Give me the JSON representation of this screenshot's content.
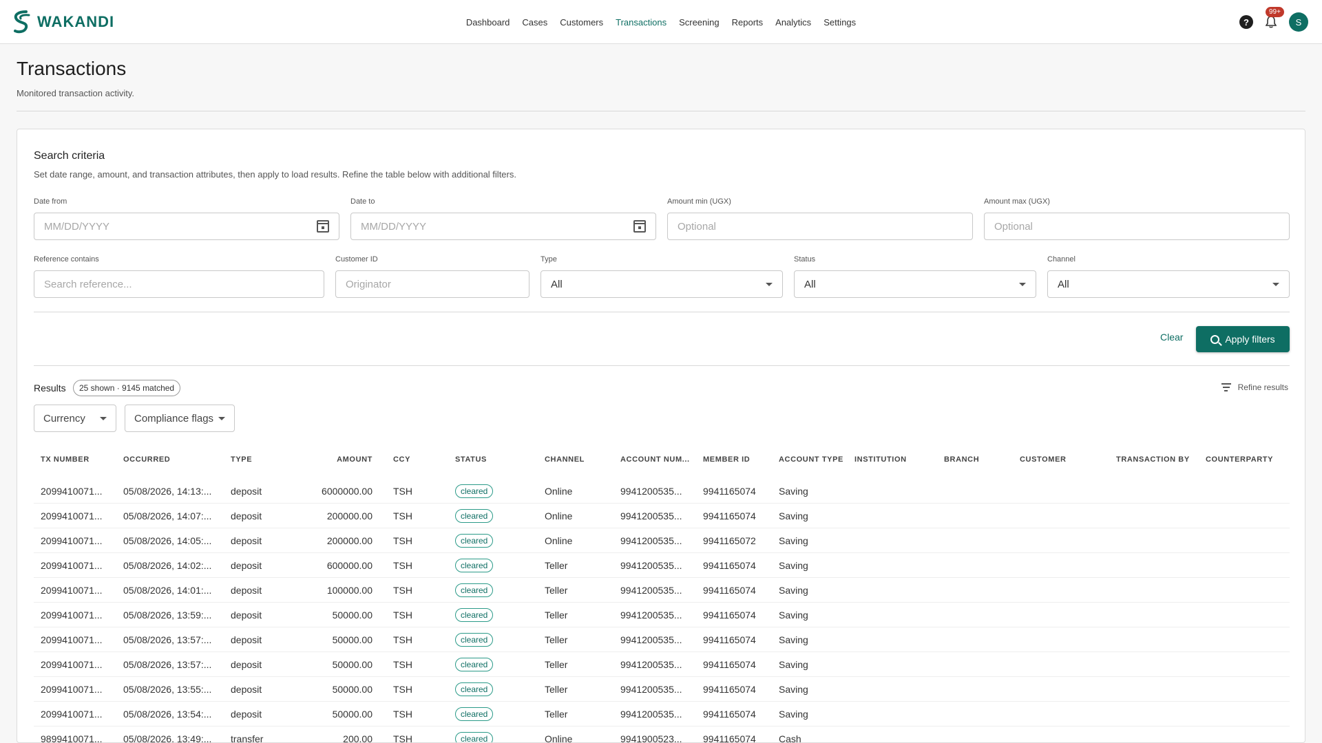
{
  "app": {
    "logo_text": "WAKANDI"
  },
  "nav": {
    "items": [
      "Dashboard",
      "Cases",
      "Customers",
      "Transactions",
      "Screening",
      "Reports",
      "Analytics",
      "Settings"
    ],
    "active": "Transactions"
  },
  "topbar": {
    "help": "?",
    "notifications_badge": "99+",
    "avatar_initial": "S"
  },
  "page": {
    "title": "Transactions",
    "subtitle": "Monitored transaction activity."
  },
  "search": {
    "title": "Search criteria",
    "description": "Set date range, amount, and transaction attributes, then apply to load results. Refine the table below with additional filters.",
    "date_from": {
      "label": "Date from",
      "placeholder": "MM/DD/YYYY"
    },
    "date_to": {
      "label": "Date to",
      "placeholder": "MM/DD/YYYY"
    },
    "amount_min": {
      "label": "Amount min (UGX)",
      "placeholder": "Optional"
    },
    "amount_max": {
      "label": "Amount max (UGX)",
      "placeholder": "Optional"
    },
    "reference": {
      "label": "Reference contains",
      "placeholder": "Search reference..."
    },
    "customer_id": {
      "label": "Customer ID",
      "placeholder": "Originator"
    },
    "type": {
      "label": "Type",
      "value": "All"
    },
    "status": {
      "label": "Status",
      "value": "All"
    },
    "channel": {
      "label": "Channel",
      "value": "All"
    },
    "clear_label": "Clear",
    "apply_label": "Apply filters"
  },
  "results": {
    "label": "Results",
    "count_chip": "25 shown · 9145 matched",
    "refine_label": "Refine results",
    "currency_filter": "Currency",
    "flags_filter": "Compliance flags"
  },
  "table": {
    "headers": [
      "TX NUMBER",
      "OCCURRED",
      "TYPE",
      "AMOUNT",
      "CCY",
      "STATUS",
      "CHANNEL",
      "ACCOUNT NUM...",
      "MEMBER ID",
      "ACCOUNT TYPE",
      "INSTITUTION",
      "BRANCH",
      "CUSTOMER",
      "TRANSACTION BY",
      "COUNTERPARTY"
    ],
    "rows": [
      [
        "2099410071...",
        "05/08/2026, 14:13:...",
        "deposit",
        "6000000.00",
        "TSH",
        "cleared",
        "Online",
        "9941200535...",
        "9941165074",
        "Saving"
      ],
      [
        "2099410071...",
        "05/08/2026, 14:07:...",
        "deposit",
        "200000.00",
        "TSH",
        "cleared",
        "Online",
        "9941200535...",
        "9941165074",
        "Saving"
      ],
      [
        "2099410071...",
        "05/08/2026, 14:05:...",
        "deposit",
        "200000.00",
        "TSH",
        "cleared",
        "Online",
        "9941200535...",
        "9941165072",
        "Saving"
      ],
      [
        "2099410071...",
        "05/08/2026, 14:02:...",
        "deposit",
        "600000.00",
        "TSH",
        "cleared",
        "Teller",
        "9941200535...",
        "9941165074",
        "Saving"
      ],
      [
        "2099410071...",
        "05/08/2026, 14:01:...",
        "deposit",
        "100000.00",
        "TSH",
        "cleared",
        "Teller",
        "9941200535...",
        "9941165074",
        "Saving"
      ],
      [
        "2099410071...",
        "05/08/2026, 13:59:...",
        "deposit",
        "50000.00",
        "TSH",
        "cleared",
        "Teller",
        "9941200535...",
        "9941165074",
        "Saving"
      ],
      [
        "2099410071...",
        "05/08/2026, 13:57:...",
        "deposit",
        "50000.00",
        "TSH",
        "cleared",
        "Teller",
        "9941200535...",
        "9941165074",
        "Saving"
      ],
      [
        "2099410071...",
        "05/08/2026, 13:57:...",
        "deposit",
        "50000.00",
        "TSH",
        "cleared",
        "Teller",
        "9941200535...",
        "9941165074",
        "Saving"
      ],
      [
        "2099410071...",
        "05/08/2026, 13:55:...",
        "deposit",
        "50000.00",
        "TSH",
        "cleared",
        "Teller",
        "9941200535...",
        "9941165074",
        "Saving"
      ],
      [
        "2099410071...",
        "05/08/2026, 13:54:...",
        "deposit",
        "50000.00",
        "TSH",
        "cleared",
        "Teller",
        "9941200535...",
        "9941165074",
        "Saving"
      ],
      [
        "9899410071...",
        "05/08/2026, 13:49:...",
        "transfer",
        "200.00",
        "TSH",
        "cleared",
        "Online",
        "9941900523...",
        "9941165074",
        "Cash"
      ]
    ]
  }
}
